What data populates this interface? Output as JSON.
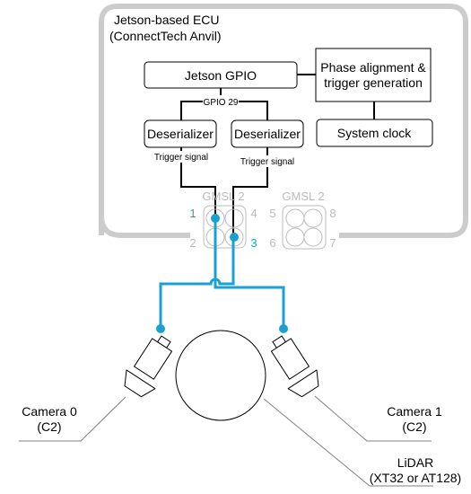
{
  "ecu": {
    "title_line1": "Jetson-based ECU",
    "title_line2": "(ConnectTech Anvil)"
  },
  "blocks": {
    "jetson_gpio": "Jetson GPIO",
    "phase_line1": "Phase alignment &",
    "phase_line2": "trigger generation",
    "system_clock": "System clock",
    "deserializer_0": "Deserializer",
    "deserializer_1": "Deserializer"
  },
  "signals": {
    "gpio": "GPIO 29",
    "trigger_0": "Trigger signal",
    "trigger_1": "Trigger signal"
  },
  "connectors": [
    {
      "label": "GMSL 2",
      "pins": [
        "1",
        "2",
        "3",
        "4"
      ]
    },
    {
      "label": "GMSL 2",
      "pins": [
        "5",
        "6",
        "7",
        "8"
      ]
    }
  ],
  "devices": {
    "camera0_line1": "Camera 0",
    "camera0_line2": "(C2)",
    "camera1_line1": "Camera 1",
    "camera1_line2": "(C2)",
    "lidar_line1": "LiDAR",
    "lidar_line2": "(XT32 or AT128)"
  },
  "colors": {
    "frame": "#cccccc",
    "cable": "#1ba1d1",
    "connector_inactive": "#bbbbbb"
  }
}
